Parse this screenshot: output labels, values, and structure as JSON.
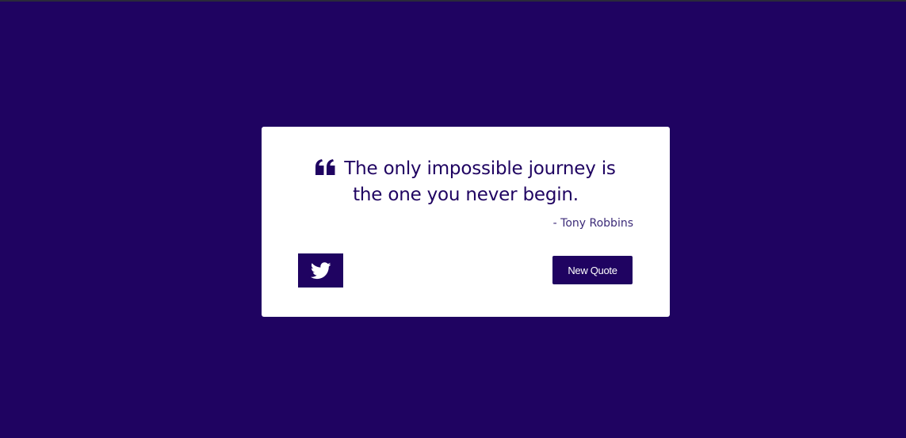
{
  "colors": {
    "background": "#1f0361",
    "card": "#ffffff",
    "accent": "#1f0361",
    "author_text": "#3c2b78"
  },
  "quote": {
    "icon": "quote-left-icon",
    "line1": "The only impossible journey is",
    "line2": "the one you never begin.",
    "author": "- Tony Robbins"
  },
  "actions": {
    "tweet_icon": "twitter-icon",
    "new_quote_label": "New Quote"
  }
}
